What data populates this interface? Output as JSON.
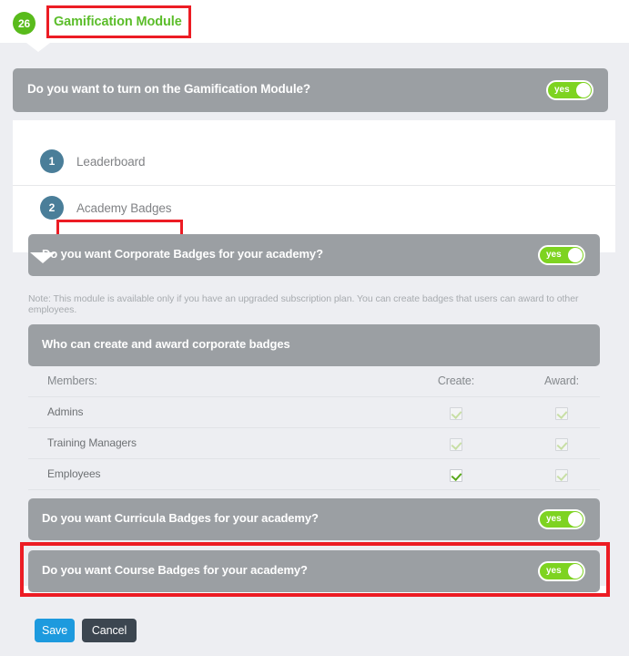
{
  "header": {
    "badge_number": "26",
    "title": "Gamification Module",
    "title_color": "#5bbd2a",
    "badge_color": "#59bb1c",
    "highlight_color": "#ec1c24"
  },
  "main_question": {
    "label": "Do you want to turn on the Gamification Module?",
    "toggle_value": "yes",
    "toggle_on": true
  },
  "steps": [
    {
      "number": "1",
      "label": "Leaderboard",
      "highlighted": false
    },
    {
      "number": "2",
      "label": "Academy Badges",
      "highlighted": true
    }
  ],
  "academy_badges": {
    "corporate_question": {
      "label": "Do you want Corporate Badges for your academy?",
      "toggle_value": "yes"
    },
    "note": "Note: This module is available only if you have an upgraded subscription plan. You can create badges that users can award to other employees.",
    "permissions": {
      "section_title": "Who can create and award corporate badges",
      "columns": {
        "members": "Members:",
        "create": "Create:",
        "award": "Award:"
      },
      "rows": [
        {
          "member": "Admins",
          "create": true,
          "create_active": false,
          "award": true,
          "award_active": false
        },
        {
          "member": "Training Managers",
          "create": true,
          "create_active": false,
          "award": true,
          "award_active": false
        },
        {
          "member": "Employees",
          "create": true,
          "create_active": true,
          "award": true,
          "award_active": false
        }
      ]
    },
    "curricula_question": {
      "label": "Do you want Curricula Badges for your academy?",
      "toggle_value": "yes"
    },
    "course_question": {
      "label": "Do you want Course Badges for your academy?",
      "toggle_value": "yes",
      "highlighted": true
    }
  },
  "footer": {
    "save_label": "Save",
    "cancel_label": "Cancel",
    "save_color": "#1d9ade",
    "cancel_color": "#3c4650"
  }
}
